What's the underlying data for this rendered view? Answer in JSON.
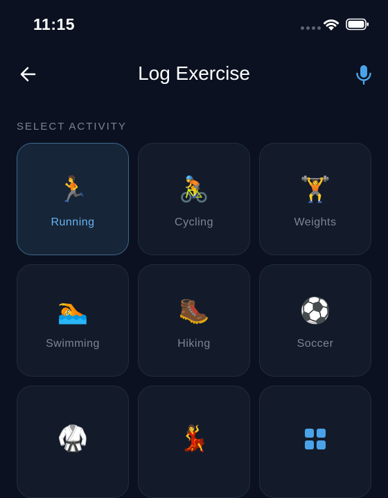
{
  "status_bar": {
    "time": "11:15"
  },
  "header": {
    "title": "Log Exercise",
    "back_icon": "arrow-left-icon",
    "mic_icon": "microphone-icon"
  },
  "section": {
    "label": "SELECT ACTIVITY"
  },
  "activities": [
    {
      "label": "Running",
      "icon": "🏃",
      "selected": true
    },
    {
      "label": "Cycling",
      "icon": "🚴",
      "selected": false
    },
    {
      "label": "Weights",
      "icon": "🏋️",
      "selected": false
    },
    {
      "label": "Swimming",
      "icon": "🏊",
      "selected": false
    },
    {
      "label": "Hiking",
      "icon": "🥾",
      "selected": false
    },
    {
      "label": "Soccer",
      "icon": "⚽",
      "selected": false
    },
    {
      "label": "",
      "icon": "🥋",
      "selected": false
    },
    {
      "label": "",
      "icon": "💃",
      "selected": false
    },
    {
      "label": "",
      "icon": "grid-icon",
      "selected": false
    }
  ],
  "colors": {
    "background": "#0b1120",
    "tile": "#131b2b",
    "accent": "#6ab4f0",
    "mic": "#4aa3e8"
  }
}
